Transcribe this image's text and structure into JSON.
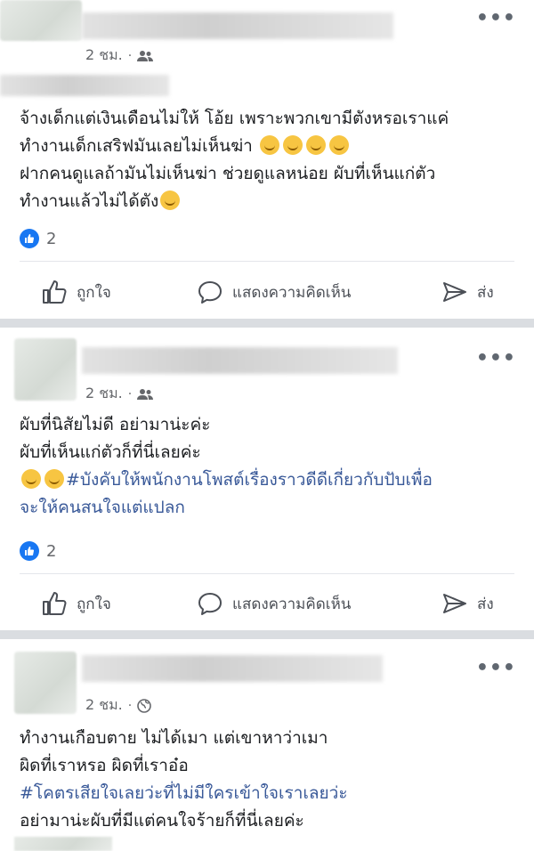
{
  "posts": [
    {
      "meta_time": "2 ชม.",
      "privacy_icon": "friends-icon",
      "lines": [
        "จ้างเด็กแต่เงินเดือนไม่ให้ โอ้ย เพราะพวกเขามีตังหรอเราแค่",
        "ทำงานเด็กเสริฟมันเลยไม่เห็นฆ่า",
        "ฝากคนดูแลถ้ามันไม่เห็นฆ่า ช่วยดูแลหน่อย ผับที่เห็นแก่ตัว",
        "ทำงานแล้วไม่ได้ตัง"
      ],
      "like_count": "2",
      "actions": {
        "like": "ถูกใจ",
        "comment": "แสดงความคิดเห็น",
        "share": "ส่ง"
      }
    },
    {
      "meta_time": "2 ชม.",
      "privacy_icon": "friends-icon",
      "lines": [
        "ผับที่นิสัยไม่ดี อย่ามาน่ะค่ะ",
        "ผับที่เห็นแก่ตัวก็ที่นี่เลยค่ะ"
      ],
      "hashtag_lines": [
        "#บังคับให้พนักงานโพสต์เรื่องราวดีดีเกี่ยวกับปับเพื่อ",
        "จะให้คนสนใจแต่แปลก"
      ],
      "like_count": "2",
      "actions": {
        "like": "ถูกใจ",
        "comment": "แสดงความคิดเห็น",
        "share": "ส่ง"
      }
    },
    {
      "meta_time": "2 ชม.",
      "privacy_icon": "globe-icon",
      "lines": [
        "ทำงานเกือบตาย ไม่ได้เมา แต่เขาหาว่าเมา",
        "ผิดที่เราหรอ ผิดที่เราอ๋อ"
      ],
      "hashtag_lines": [
        "#โคตรเสียใจเลยว่ะที่ไม่มีใครเข้าใจเราเลยว่ะ"
      ],
      "tail_lines": [
        "อย่ามาน่ะผับที่มีแต่คนใจร้ายก็ที่นี่เลยค่ะ"
      ]
    }
  ],
  "colors": {
    "link": "#385898",
    "like_blue": "#1877f2",
    "separator": "#dadde1"
  }
}
